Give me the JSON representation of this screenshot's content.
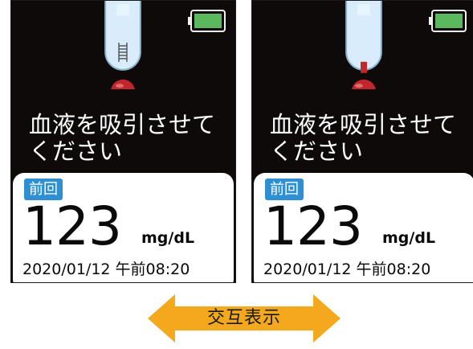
{
  "screens": [
    {
      "message_line1": "血液を吸引させて",
      "message_line2": "ください",
      "previous_badge": "前回",
      "reading_value": "123",
      "reading_unit": "mg/dL",
      "reading_datetime": "2020/01/12 午前08:20"
    },
    {
      "message_line1": "血液を吸引させて",
      "message_line2": "ください",
      "previous_badge": "前回",
      "reading_value": "123",
      "reading_unit": "mg/dL",
      "reading_datetime": "2020/01/12 午前08:20"
    }
  ],
  "alternate_label": "交互表示",
  "colors": {
    "screen_bg": "#0e0a0a",
    "battery": "#5cb85c",
    "badge": "#2f8fd3",
    "blood": "#c0262b",
    "arrow": "#f4a81e",
    "strip": "#d8ecfb"
  },
  "icons": [
    "battery-icon",
    "test-strip-icon",
    "blood-drop-icon",
    "double-arrow-icon"
  ]
}
